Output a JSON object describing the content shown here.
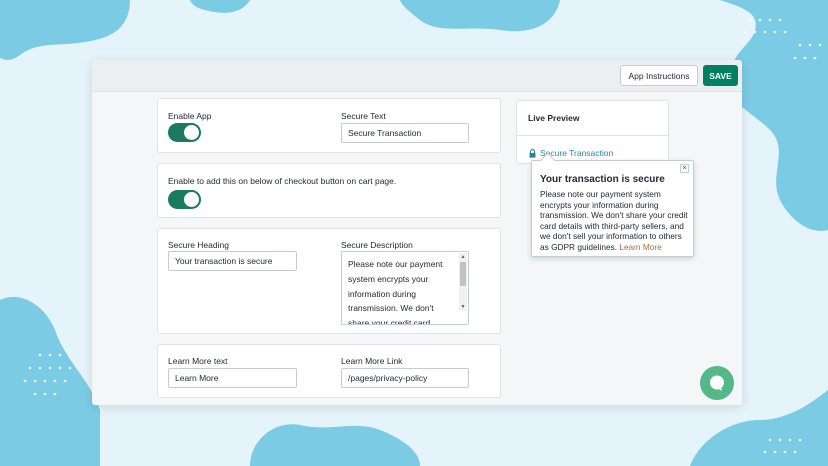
{
  "toolbar": {
    "instructions_label": "App Instructions",
    "save_label": "SAVE"
  },
  "enable_card": {
    "enable_label": "Enable App",
    "enable_on": true,
    "secure_text_label": "Secure Text",
    "secure_text_value": "Secure Transaction"
  },
  "checkout_card": {
    "label": "Enable to add this on below of checkout button on cart page.",
    "enabled": true
  },
  "heading_card": {
    "heading_label": "Secure Heading",
    "heading_value": "Your transaction is secure",
    "description_label": "Secure Description",
    "description_value": "Please note our payment system encrypts your information during transmission. We don't share your credit card details with"
  },
  "learn_card": {
    "text_label": "Learn More text",
    "text_value": "Learn More",
    "link_label": "Learn More Link",
    "link_value": "/pages/privacy-policy"
  },
  "preview": {
    "title": "Live Preview",
    "link_text": "Secure Transaction",
    "popover_title": "Your transaction is secure",
    "popover_body": "Please note our payment system encrypts your information during transmission. We don't share your credit card details with third-party sellers, and we don't sell your information to others as GDPR guidelines.",
    "popover_more": "Learn More",
    "close_glyph": "×"
  },
  "colors": {
    "primary": "#008060",
    "toggle": "#1a7a5e",
    "link": "#2b84a6",
    "learn_more": "#b5673c",
    "chat": "#54b889"
  },
  "icons": [
    "lock-icon",
    "close-icon",
    "chat-icon"
  ]
}
